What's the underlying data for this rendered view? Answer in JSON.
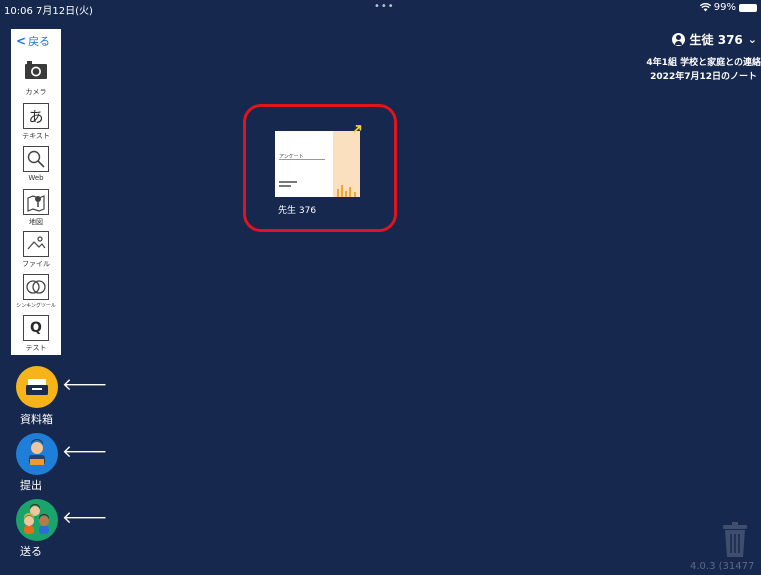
{
  "status_bar": {
    "time": "10:06",
    "date": "7月12日(火)",
    "wifi": "wifi-icon",
    "battery_percent": "99%"
  },
  "header": {
    "user_name": "生徒 376",
    "class_title": "4年1組 学校と家庭との連絡",
    "note_date": "2022年7月12日のノート"
  },
  "toolbar": {
    "back_label": "戻る",
    "tools": [
      {
        "label": "カメラ",
        "icon": "camera-icon"
      },
      {
        "label": "テキスト",
        "icon": "text-icon",
        "glyph": "あ"
      },
      {
        "label": "Web",
        "icon": "web-search-icon"
      },
      {
        "label": "地図",
        "icon": "map-icon"
      },
      {
        "label": "ファイル",
        "icon": "file-image-icon"
      },
      {
        "label": "シンキングツール",
        "icon": "thinking-tool-icon"
      },
      {
        "label": "テスト",
        "icon": "test-icon",
        "glyph": "Q"
      }
    ]
  },
  "card": {
    "thumbnail_title": "アンケート",
    "author": "先生 376"
  },
  "actions": [
    {
      "label": "資料箱",
      "color": "#f4b41a"
    },
    {
      "label": "提出",
      "color": "#1f7fd8"
    },
    {
      "label": "送る",
      "color": "#1aa36b"
    }
  ],
  "footer": {
    "version": "4.0.3 (31477"
  },
  "colors": {
    "background": "#17284e",
    "highlight": "#e0141e",
    "back_link": "#1e73e8"
  }
}
